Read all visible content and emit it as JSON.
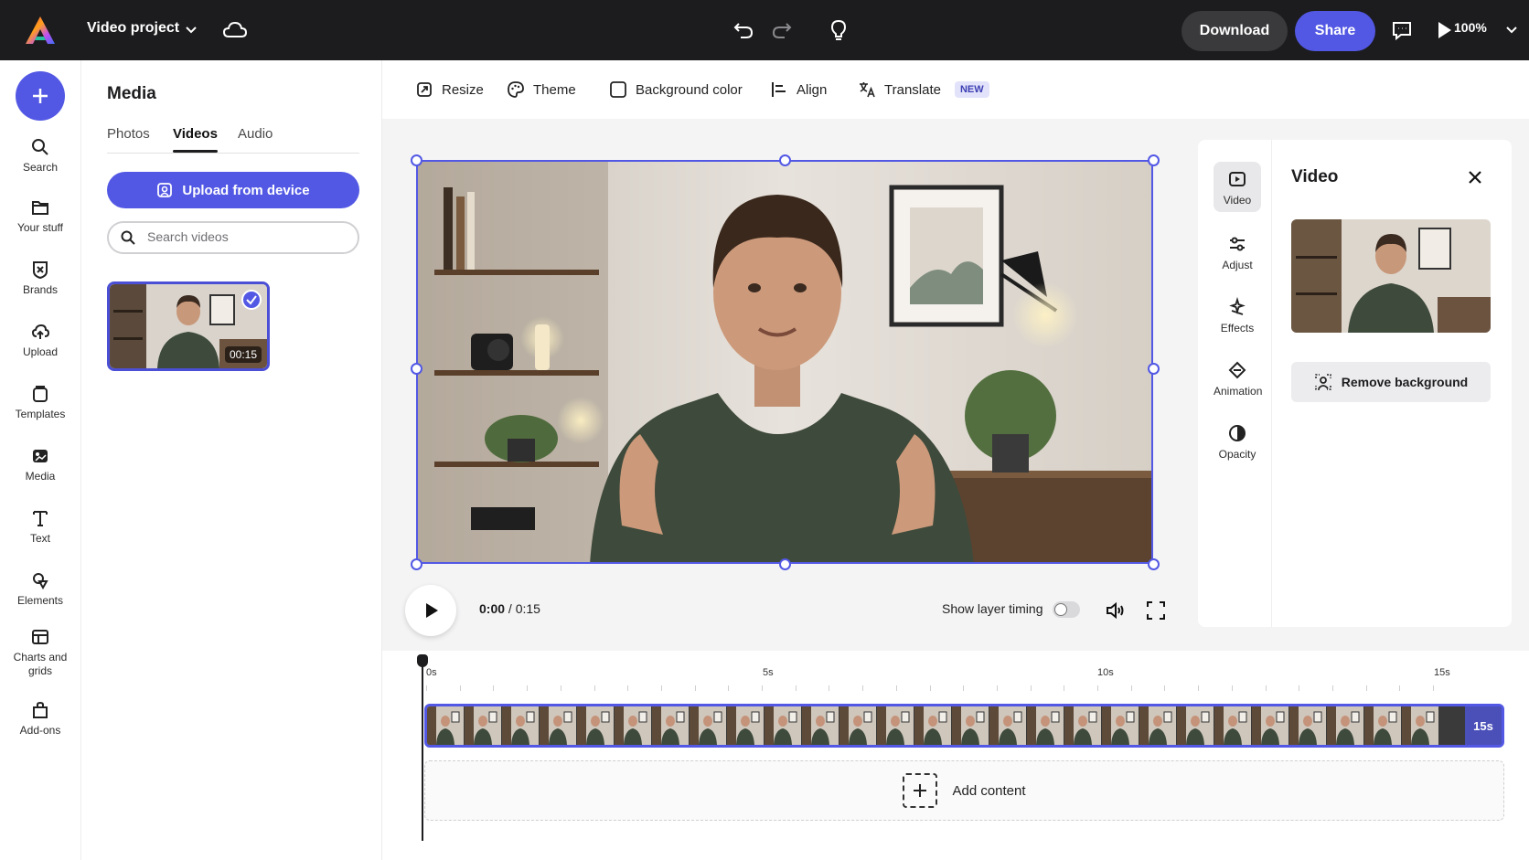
{
  "app": {
    "project_title": "Video project",
    "download_label": "Download",
    "share_label": "Share",
    "zoom": "100%",
    "icons": [
      "app-logo-icon",
      "chevron-down-icon",
      "cloud-icon",
      "undo-icon",
      "redo-icon",
      "lightbulb-icon",
      "comment-icon",
      "play-icon"
    ]
  },
  "rail": {
    "items": [
      {
        "label": "Search",
        "icon": "search-icon"
      },
      {
        "label": "Your stuff",
        "icon": "folder-icon"
      },
      {
        "label": "Brands",
        "icon": "brands-icon"
      },
      {
        "label": "Upload",
        "icon": "upload-cloud-icon"
      },
      {
        "label": "Templates",
        "icon": "templates-icon"
      },
      {
        "label": "Media",
        "icon": "media-icon",
        "active": true
      },
      {
        "label": "Text",
        "icon": "text-icon"
      },
      {
        "label": "Elements",
        "icon": "elements-icon"
      },
      {
        "label": "Charts and grids",
        "icon": "charts-grids-icon"
      },
      {
        "label": "Add-ons",
        "icon": "add-ons-icon"
      }
    ]
  },
  "media": {
    "title": "Media",
    "tabs": [
      "Photos",
      "Videos",
      "Audio"
    ],
    "active_tab": "Videos",
    "upload_label": "Upload from device",
    "search_placeholder": "Search videos",
    "thumbnail_duration": "00:15"
  },
  "canvas_toolbar": {
    "resize": "Resize",
    "theme": "Theme",
    "background_color": "Background color",
    "align": "Align",
    "translate": "Translate",
    "new_badge": "NEW"
  },
  "playback": {
    "current": "0:00",
    "separator": "/",
    "total": "0:15",
    "show_layer_timing": "Show layer timing",
    "layer_timing_on": false
  },
  "properties": {
    "tabs": [
      {
        "label": "Video",
        "icon": "video-icon",
        "active": true
      },
      {
        "label": "Adjust",
        "icon": "adjust-sliders-icon"
      },
      {
        "label": "Effects",
        "icon": "effects-sparkle-icon"
      },
      {
        "label": "Animation",
        "icon": "animation-icon"
      },
      {
        "label": "Opacity",
        "icon": "opacity-icon"
      }
    ],
    "title": "Video",
    "remove_background": "Remove background"
  },
  "timeline": {
    "ticks": [
      "0s",
      "5s",
      "10s",
      "15s"
    ],
    "clip_end_label": "15s",
    "add_content": "Add content"
  },
  "colors": {
    "accent": "#5258e4",
    "topbar": "#1c1c1e"
  }
}
